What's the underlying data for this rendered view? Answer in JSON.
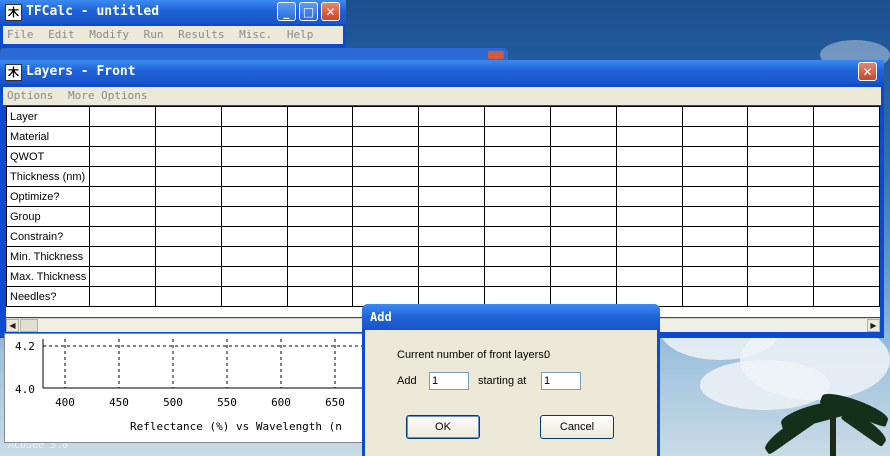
{
  "main_window": {
    "title": "TFCalc - untitled",
    "menu": [
      "File",
      "Edit",
      "Modify",
      "Run",
      "Results",
      "Misc.",
      "Help"
    ]
  },
  "layers_window": {
    "title": "Layers - Front",
    "menu": [
      "Options",
      "More Options"
    ],
    "row_labels": [
      "Layer",
      "Material",
      "QWOT",
      "Thickness (nm)",
      "Optimize?",
      "Group",
      "Constrain?",
      "Min. Thickness",
      "Max. Thickness",
      "Needles?"
    ]
  },
  "plot": {
    "y_ticks": [
      "4.2",
      "4.0"
    ],
    "x_ticks": [
      "400",
      "450",
      "500",
      "550",
      "600",
      "650"
    ],
    "caption": "Reflectance (%)  vs  Wavelength (n"
  },
  "add_dialog": {
    "title": "Add",
    "current_label": "Current number of front layers:",
    "current_value": "0",
    "add_label": "Add",
    "add_value": "1",
    "starting_label": "starting at",
    "starting_value": "1",
    "ok_label": "OK",
    "cancel_label": "Cancel"
  },
  "desktop": {
    "label": "ACDSee 5.0"
  },
  "colors": {
    "titlebar": "#1f62d8",
    "close_button": "#c8462a",
    "dialog_face": "#ece9d8"
  },
  "icons": {
    "app": "tfcalc-app-icon",
    "minimize": "minimize-icon",
    "maximize": "maximize-icon",
    "close": "close-icon"
  }
}
